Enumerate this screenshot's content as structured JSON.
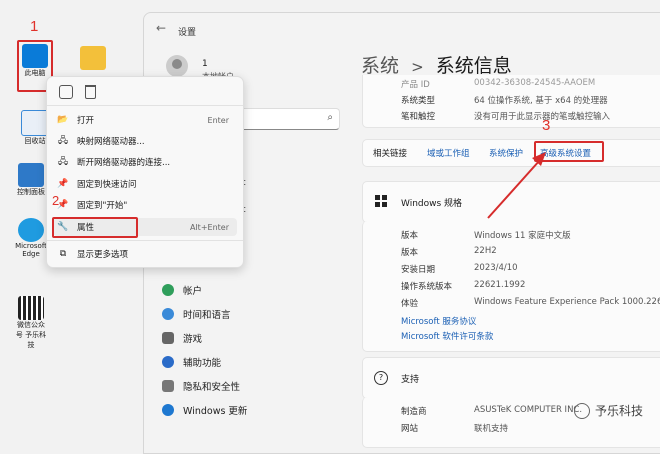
{
  "annotations": {
    "step1": "1",
    "step3": "3"
  },
  "desktop": {
    "icons": [
      {
        "name": "此电脑",
        "label": "此电脑",
        "color": "#0a7bd8"
      },
      {
        "name": "folder",
        "label": "",
        "color": "#f3c03a"
      },
      {
        "name": "recycle-bin",
        "label": "回收站",
        "color": "#3a8ad8"
      },
      {
        "name": "control-panel",
        "label": "控制面板",
        "color": "#2e79c8"
      },
      {
        "name": "edge",
        "label": "Microsoft Edge",
        "color": "#1f9be0"
      },
      {
        "name": "qrcode",
        "label": "微信公众号 予乐科技",
        "color": "#222222"
      }
    ]
  },
  "window": {
    "title": "设置",
    "user_initial": "1",
    "user_sub": "本地帐户",
    "heading": {
      "crumb": "系统",
      "sep": ">",
      "page": "系统信息"
    },
    "nav": [
      {
        "label": "帐户",
        "color": "#2f9e5b"
      },
      {
        "label": "时间和语言",
        "color": "#3a8ad8"
      },
      {
        "label": "游戏",
        "color": "#666666"
      },
      {
        "label": "辅助功能",
        "color": "#2a6bc8"
      },
      {
        "label": "隐私和安全性",
        "color": "#777777"
      },
      {
        "label": "Windows 更新",
        "color": "#1e78d0"
      }
    ],
    "partial_sidebar_text": [
      "t",
      "t"
    ],
    "device_specs": [
      {
        "k": "产品 ID",
        "v": "00342-36308-24545-AAOEM"
      },
      {
        "k": "系统类型",
        "v": "64 位操作系统, 基于 x64 的处理器"
      },
      {
        "k": "笔和触控",
        "v": "没有可用于此显示器的笔或触控输入"
      }
    ],
    "related_links": {
      "label": "相关链接",
      "links": [
        "域或工作组",
        "系统保护",
        "高级系统设置"
      ]
    },
    "windows_spec": {
      "title": "Windows 规格",
      "rows": [
        {
          "k": "版本",
          "v": "Windows 11 家庭中文版"
        },
        {
          "k": "版本",
          "v": "22H2"
        },
        {
          "k": "安装日期",
          "v": "2023/4/10"
        },
        {
          "k": "操作系统版本",
          "v": "22621.1992"
        },
        {
          "k": "体验",
          "v": "Windows Feature Experience Pack 1000.22644"
        }
      ],
      "links": [
        "Microsoft 服务协议",
        "Microsoft 软件许可条款"
      ]
    },
    "support": {
      "title": "支持",
      "rows": [
        {
          "k": "制造商",
          "v": "ASUSTeK COMPUTER INC."
        },
        {
          "k": "网站",
          "v": "联机支持"
        }
      ]
    }
  },
  "context_menu": {
    "top_icons": [
      "ai-icon",
      "trash-icon"
    ],
    "items": [
      {
        "icon": "📂",
        "label": "打开",
        "shortcut": "Enter"
      },
      {
        "icon": "🖧",
        "label": "映射网络驱动器...",
        "shortcut": ""
      },
      {
        "icon": "🖧",
        "label": "断开网络驱动器的连接...",
        "shortcut": ""
      },
      {
        "icon": "📌",
        "label": "固定到快速访问",
        "shortcut": ""
      },
      {
        "icon": "📌",
        "label": "固定到\"开始\"",
        "shortcut": ""
      },
      {
        "icon": "🔧",
        "label": "属性",
        "shortcut": "Alt+Enter"
      },
      {
        "icon": "⧉",
        "label": "显示更多选项",
        "shortcut": ""
      }
    ],
    "step2": "2"
  },
  "watermark": {
    "text": "予乐科技"
  },
  "colors": {
    "accent": "#1a5fb4",
    "annotation_red": "#d62c2c"
  }
}
